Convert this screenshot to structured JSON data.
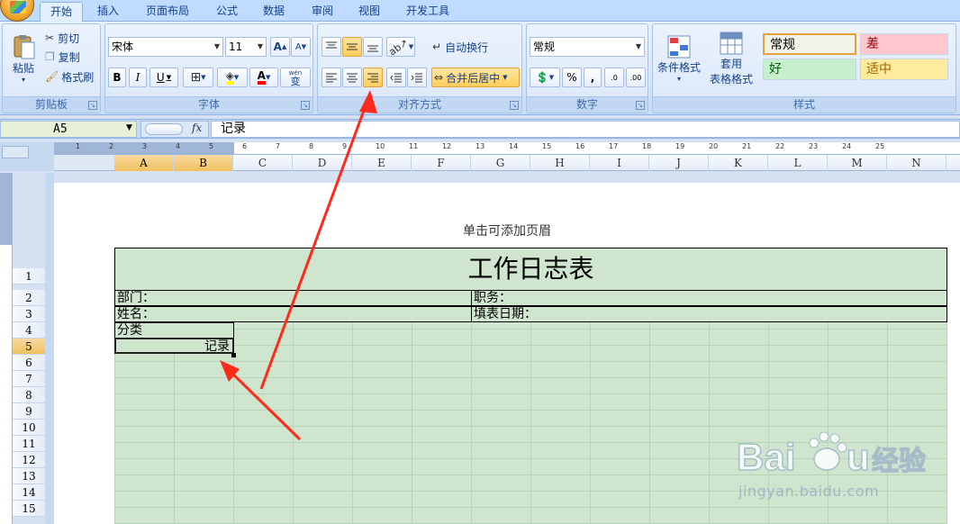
{
  "tabs": [
    {
      "label": "开始",
      "active": true
    },
    {
      "label": "插入",
      "active": false
    },
    {
      "label": "页面布局",
      "active": false
    },
    {
      "label": "公式",
      "active": false
    },
    {
      "label": "数据",
      "active": false
    },
    {
      "label": "审阅",
      "active": false
    },
    {
      "label": "视图",
      "active": false
    },
    {
      "label": "开发工具",
      "active": false
    }
  ],
  "ribbon": {
    "clipboard": {
      "paste": "粘贴",
      "cut": "剪切",
      "copy": "复制",
      "format_painter": "格式刷",
      "group_label": "剪贴板"
    },
    "font": {
      "name": "宋体",
      "size": "11",
      "grow": "A",
      "shrink": "A",
      "bold": "B",
      "italic": "I",
      "underline": "U",
      "color_letter": "A",
      "phonetic": "wén",
      "phonetic_char": "变",
      "group_label": "字体"
    },
    "alignment": {
      "wrap": "自动换行",
      "merge": "合并后居中",
      "group_label": "对齐方式"
    },
    "number": {
      "format": "常规",
      "percent": "%",
      "comma": ",",
      "inc_decimal": ".0",
      "dec_decimal": ".00",
      "group_label": "数字"
    },
    "styles": {
      "conditional": "条件格式",
      "table_format_line1": "套用",
      "table_format_line2": "表格格式",
      "normal": "常规",
      "bad": "差",
      "good": "好",
      "neutral": "适中",
      "group_label": "样式"
    }
  },
  "formula_bar": {
    "name_box": "A5",
    "fx": "fx",
    "content": "记录"
  },
  "columns": [
    "A",
    "B",
    "C",
    "D",
    "E",
    "F",
    "G",
    "H",
    "I",
    "J",
    "K",
    "L",
    "M",
    "N"
  ],
  "selected_column": [
    "A",
    "B"
  ],
  "rows": [
    "1",
    "2",
    "3",
    "4",
    "5",
    "6",
    "7",
    "8",
    "9",
    "10",
    "11",
    "12",
    "13",
    "14",
    "15"
  ],
  "selected_row": "5",
  "ruler_numbers": [
    "1",
    "2",
    "3",
    "4",
    "5",
    "6",
    "7",
    "8",
    "9",
    "10",
    "11",
    "12",
    "13",
    "14",
    "15",
    "16",
    "17",
    "18",
    "19",
    "20",
    "21",
    "22",
    "23",
    "24",
    "25"
  ],
  "page": {
    "header_hint": "单击可添加页眉",
    "title": "工作日志表",
    "department": "部门：",
    "position": "职务：",
    "name": "姓名：",
    "fill_date": "填表日期：",
    "category": "分类",
    "record": "记录"
  },
  "watermark": {
    "logo": "Bai du 经验",
    "url": "jingyan.baidu.com"
  },
  "colors": {
    "accent": "#15428b",
    "sheet_bg": "#cfe5cd",
    "arrow": "#ff2a1a",
    "selected": "#f1c15f"
  }
}
